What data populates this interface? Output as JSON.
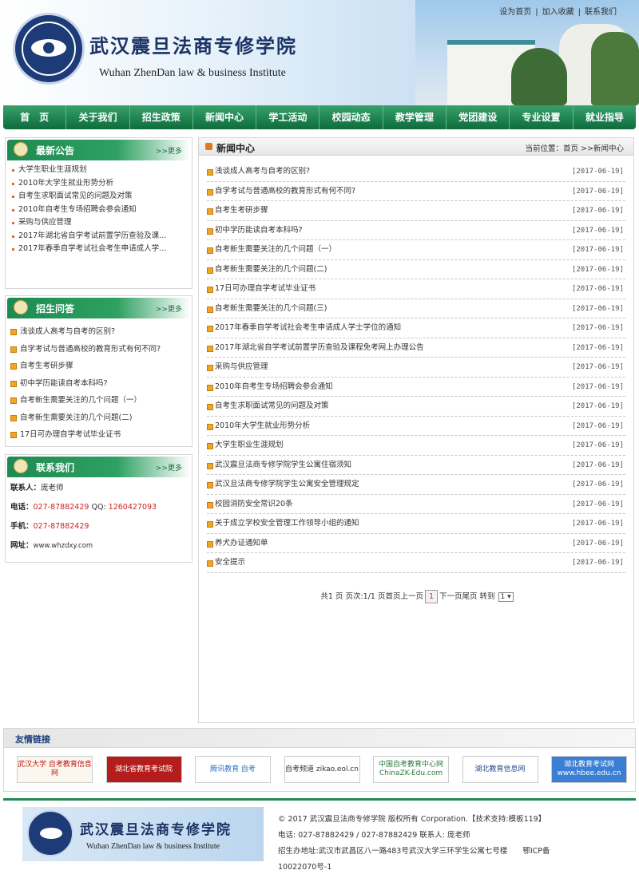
{
  "header": {
    "site_cn": "武汉震旦法商专修学院",
    "site_en": "Wuhan ZhenDan law & business Institute",
    "top_links": [
      "设为首页",
      "加入收藏",
      "联系我们"
    ]
  },
  "nav": [
    "首　页",
    "关于我们",
    "招生政策",
    "新闻中心",
    "学工活动",
    "校园动态",
    "教学管理",
    "党团建设",
    "专业设置",
    "就业指导"
  ],
  "notice": {
    "title": "最新公告",
    "more": ">>更多",
    "items": [
      "大学生职业生涯规划",
      "2010年大学生就业形势分析",
      "自考生求职面试常见的问题及对策",
      "2010年自考生专场招聘会参会通知",
      "采购与供应管理",
      "2017年湖北省自学考试前置学历查验及课...",
      "2017年春季自学考试社会考生申请成人学..."
    ]
  },
  "qa": {
    "title": "招生问答",
    "more": ">>更多",
    "items": [
      "浅谈成人高考与自考的区别?",
      "自学考试与普通高校的教育形式有何不同?",
      "自考生考研步骤",
      "初中学历能读自考本科吗?",
      "自考新生需要关注的几个问题（一）",
      "自考新生需要关注的几个问题(二)",
      "17日可办理自学考试毕业证书"
    ]
  },
  "contact": {
    "title": "联系我们",
    "more": ">>更多",
    "person_k": "联系人：",
    "person_v": "庞老师",
    "phone_k": "电话：",
    "phone_v": "027-87882429",
    "qq_k": "QQ:",
    "qq_v": "1260427093",
    "mobile_k": "手机：",
    "mobile_v": "027-87882429",
    "web_k": "网址：",
    "web_v": "www.whzdxy.com"
  },
  "main": {
    "title": "新闻中心",
    "position": "当前位置：首页 >>新闻中心",
    "articles": [
      {
        "title": "浅谈成人高考与自考的区别?",
        "date": "[2017-06-19]"
      },
      {
        "title": "自学考试与普通高校的教育形式有何不同?",
        "date": "[2017-06-19]"
      },
      {
        "title": "自考生考研步骤",
        "date": "[2017-06-19]"
      },
      {
        "title": "初中学历能读自考本科吗?",
        "date": "[2017-06-19]"
      },
      {
        "title": "自考新生需要关注的几个问题（一）",
        "date": "[2017-06-19]"
      },
      {
        "title": "自考新生需要关注的几个问题(二)",
        "date": "[2017-06-19]"
      },
      {
        "title": "17日可办理自学考试毕业证书",
        "date": "[2017-06-19]"
      },
      {
        "title": "自考新生需要关注的几个问题(三)",
        "date": "[2017-06-19]"
      },
      {
        "title": "2017年春季自学考试社会考生申请成人学士学位的通知",
        "date": "[2017-06-19]"
      },
      {
        "title": "2017年湖北省自学考试前置学历查验及课程免考网上办理公告",
        "date": "[2017-06-19]"
      },
      {
        "title": "采购与供应管理",
        "date": "[2017-06-19]"
      },
      {
        "title": "2010年自考生专场招聘会参会通知",
        "date": "[2017-06-19]"
      },
      {
        "title": "自考生求职面试常见的问题及对策",
        "date": "[2017-06-19]"
      },
      {
        "title": "2010年大学生就业形势分析",
        "date": "[2017-06-19]"
      },
      {
        "title": "大学生职业生涯规划",
        "date": "[2017-06-19]"
      },
      {
        "title": "武汉震旦法商专修学院学生公寓住宿须知",
        "date": "[2017-06-19]"
      },
      {
        "title": "武汉旦法商专修学院学生公寓安全管理规定",
        "date": "[2017-06-19]"
      },
      {
        "title": "校园消防安全常识20条",
        "date": "[2017-06-19]"
      },
      {
        "title": "关于成立学校安全管理工作领导小组的通知",
        "date": "[2017-06-19]"
      },
      {
        "title": "养犬办证通知单",
        "date": "[2017-06-19]"
      },
      {
        "title": "安全提示",
        "date": "[2017-06-19]"
      }
    ],
    "pager": {
      "prefix": "共1 页 页次:1/1 页首页上一页",
      "current": "1",
      "suffix": "下一页尾页  转到",
      "select": "1 ▾"
    }
  },
  "links": {
    "title": "友情链接",
    "items": [
      "武汉大学 自考教育信息网",
      "湖北省教育考试院",
      "腾讯教育 自考",
      "自考频道 zikao.eol.cn",
      "中国自考教育中心网 ChinaZK-Edu.com",
      "湖北教育信息网",
      "湖北教育考试网 www.hbee.edu.cn"
    ]
  },
  "footer": {
    "logo_cn": "武汉震旦法商专修学院",
    "logo_en": "Wuhan ZhenDan law & business Institute",
    "copyright": "© 2017 武汉震旦法商专修学院 版权所有 Corporation.【技术支持:模板119】",
    "contact": "电话: 027-87882429 / 027-87882429 联系人: 庞老师",
    "address": "招生办地址:武汉市武昌区八一路483号武汉大学三环学生公寓七号楼　　鄂ICP备",
    "icp": "10022070号-1"
  },
  "colors": {
    "nav_green": "#1f8452",
    "title_blue": "#1b3365",
    "accent_orange": "#f0a526",
    "contact_red": "#d02020"
  }
}
